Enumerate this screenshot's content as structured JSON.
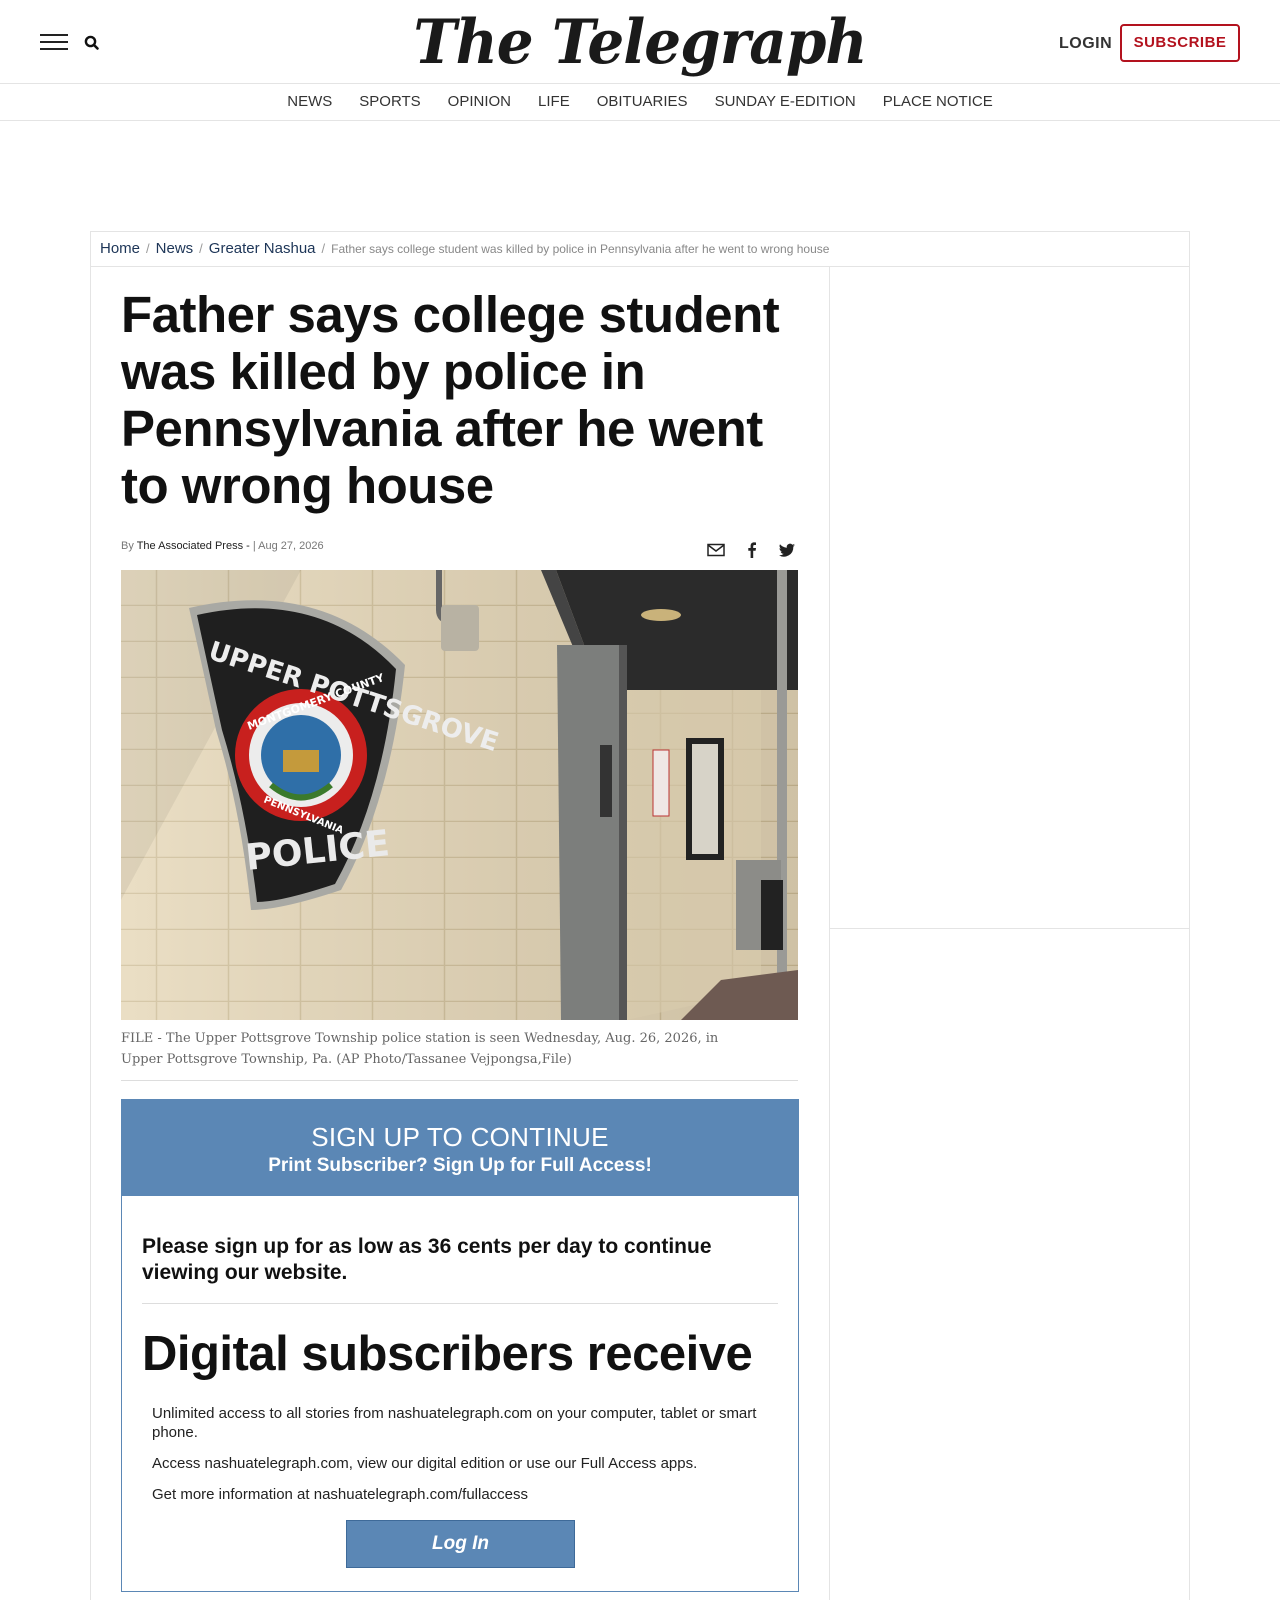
{
  "header": {
    "logo": "The Telegraph",
    "login_label": "LOGIN",
    "subscribe_label": "SUBSCRIBE"
  },
  "nav": {
    "items": [
      "NEWS",
      "SPORTS",
      "OPINION",
      "LIFE",
      "OBITUARIES",
      "SUNDAY E-EDITION",
      "PLACE NOTICE"
    ]
  },
  "breadcrumb": {
    "home": "Home",
    "news": "News",
    "section": "Greater Nashua",
    "current": "Father says college student was killed by police in Pennsylvania after he went to wrong house"
  },
  "article": {
    "headline": "Father says college student was killed by police in Pennsylvania after he went to wrong house",
    "by_prefix": "By",
    "author": "The Associated Press -",
    "date": "| Aug 27, 2026",
    "caption": "FILE - The Upper Pottsgrove Township police station is seen Wednesday, Aug. 26, 2026, in Upper Pottsgrove Township, Pa. (AP Photo/Tassanee Vejpongsa,File)",
    "badge_top": "UPPER POTTSGROVE",
    "badge_ring_top": "MONTGOMERY COUNTY",
    "badge_ring_bottom": "PENNSYLVANIA",
    "badge_bottom": "POLICE"
  },
  "paywall": {
    "title": "SIGN UP TO CONTINUE",
    "subtitle": "Print Subscriber? Sign Up for Full Access!",
    "lead": "Please sign up for as low as 36 cents per day to continue viewing our website.",
    "heading": "Digital subscribers receive",
    "benefits": [
      "Unlimited access to all stories from nashuatelegraph.com on your computer, tablet or smart phone.",
      "Access nashuatelegraph.com, view our digital edition or use our Full Access apps.",
      "Get more information at nashuatelegraph.com/fullaccess"
    ],
    "button": "Log In"
  },
  "colors": {
    "brand_red": "#b3121e",
    "paywall_blue": "#5b87b5"
  }
}
